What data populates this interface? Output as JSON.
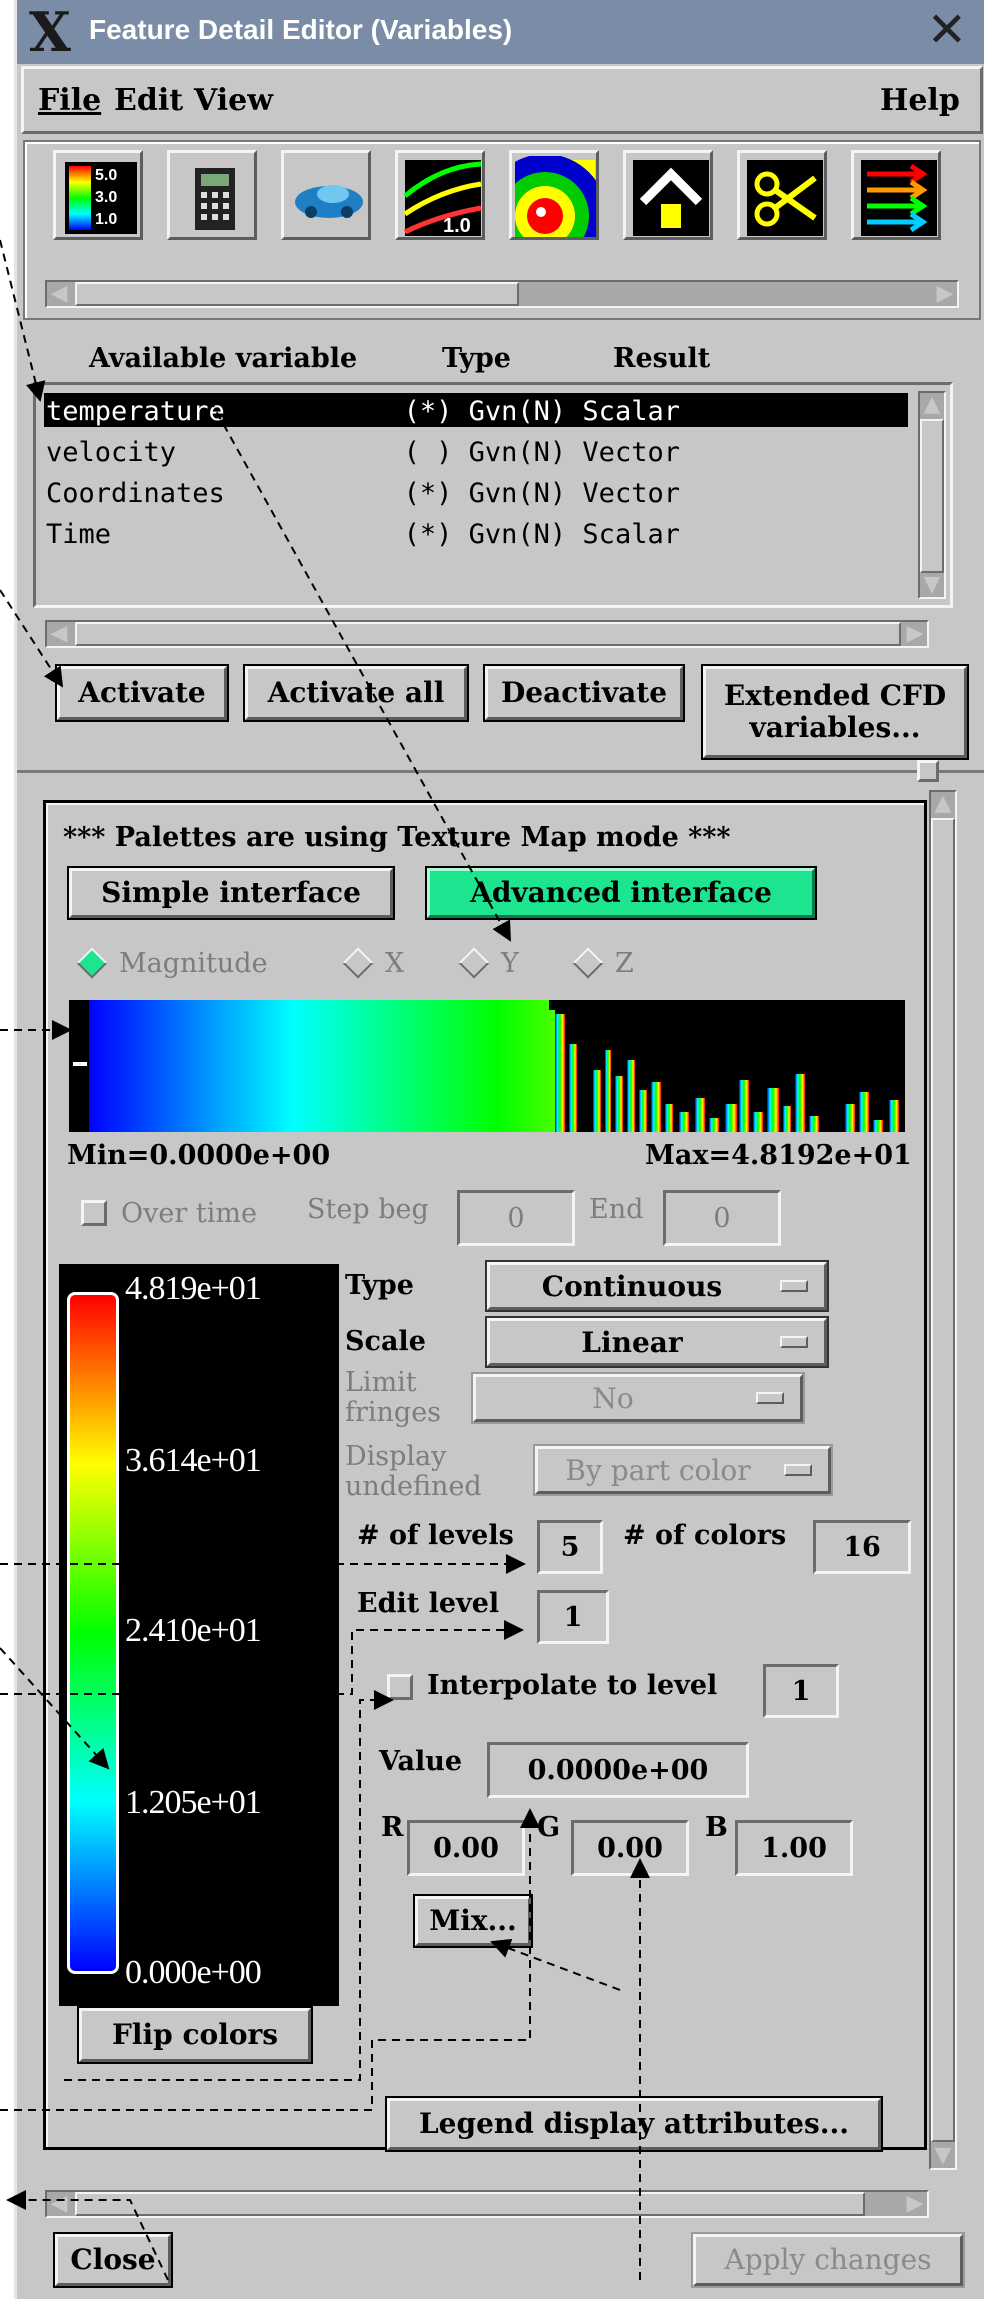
{
  "window": {
    "title": "Feature Detail Editor (Variables)",
    "close_glyph": "✕"
  },
  "menubar": {
    "file": "File",
    "edit": "Edit",
    "view": "View",
    "help": "Help"
  },
  "toolbar": {
    "legend_icon_values": [
      "5.0",
      "3.0",
      "1.0"
    ],
    "contour_icon_value": "1.0",
    "tools": [
      "color-legend-icon",
      "calculator-icon",
      "car-model-icon",
      "contour-icon",
      "sphere-isosurface-icon",
      "arrow-house-icon",
      "scissors-icon",
      "vector-arrows-icon"
    ]
  },
  "variables": {
    "headers": {
      "name": "Available variable",
      "type": "Type",
      "result": "Result"
    },
    "rows": [
      {
        "text": "temperature           (*) Gvn(N) Scalar",
        "selected": true
      },
      {
        "text": "velocity              ( ) Gvn(N) Vector",
        "selected": false
      },
      {
        "text": "Coordinates           (*) Gvn(N) Vector",
        "selected": false
      },
      {
        "text": "Time                  (*) Gvn(N) Scalar",
        "selected": false
      }
    ],
    "buttons": {
      "activate": "Activate",
      "activate_all": "Activate all",
      "deactivate": "Deactivate",
      "extended_line1": "Extended CFD",
      "extended_line2": "variables..."
    }
  },
  "palette": {
    "notice": "*** Palettes are using Texture Map mode ***",
    "simple": "Simple interface",
    "advanced": "Advanced interface",
    "components": [
      "Magnitude",
      "X",
      "Y",
      "Z"
    ],
    "selected_component": "Magnitude",
    "min": "Min=0.0000e+00",
    "max": "Max=4.8192e+01",
    "over_time": "Over time",
    "step_beg": "Step beg",
    "step_beg_val": "0",
    "end": "End",
    "end_val": "0",
    "legend_ticks": [
      "4.819e+01",
      "3.614e+01",
      "2.410e+01",
      "1.205e+01",
      "0.000e+00"
    ],
    "type_label": "Type",
    "type_value": "Continuous",
    "scale_label": "Scale",
    "scale_value": "Linear",
    "limit_l1": "Limit",
    "limit_l2": "fringes",
    "limit_value": "No",
    "display_l1": "Display",
    "display_l2": "undefined",
    "display_value": "By part color",
    "levels_label": "# of levels",
    "levels_value": "5",
    "colors_label": "# of colors",
    "colors_value": "16",
    "edit_level_label": "Edit level",
    "edit_level_value": "1",
    "interpolate_label": "Interpolate to level",
    "interpolate_value": "1",
    "value_label": "Value",
    "value_value": "0.0000e+00",
    "r_label": "R",
    "r_value": "0.00",
    "g_label": "G",
    "g_value": "0.00",
    "b_label": "B",
    "b_value": "1.00",
    "mix": "Mix...",
    "flip": "Flip colors",
    "legend_attrs": "Legend display attributes..."
  },
  "footer": {
    "close": "Close",
    "apply": "Apply changes"
  },
  "colors": {
    "title_bg": "#7b8da6",
    "panel": "#c7c7c7",
    "accent_green": "#1de58f",
    "selection": "#000000"
  }
}
